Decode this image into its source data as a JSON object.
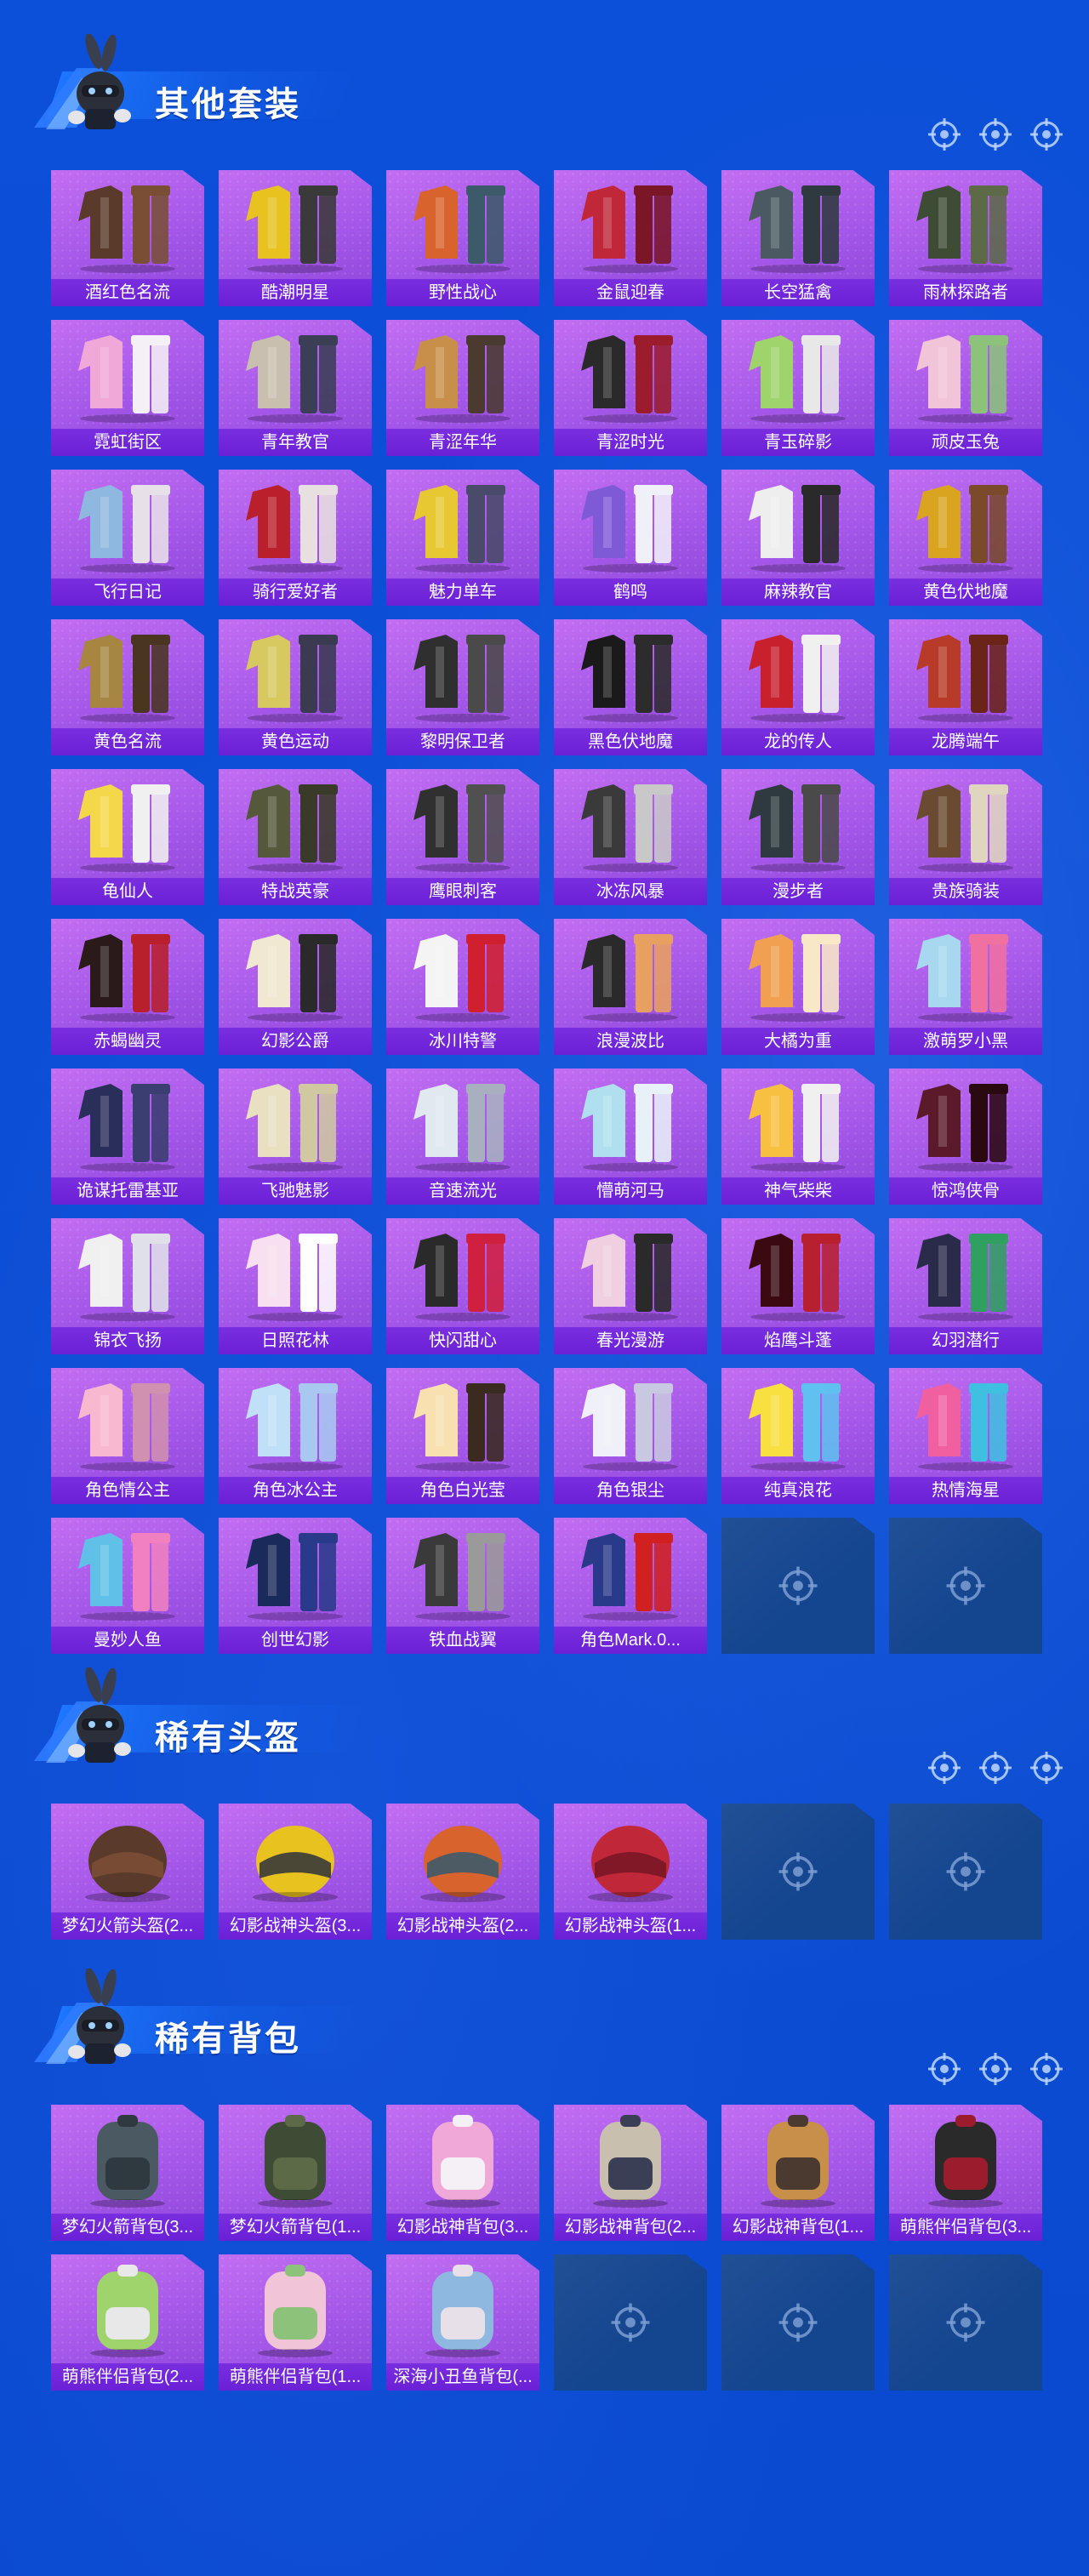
{
  "sections": [
    {
      "title": "其他套装",
      "items": [
        "酒红色名流",
        "酷潮明星",
        "野性战心",
        "金鼠迎春",
        "长空猛禽",
        "雨林探路者",
        "霓虹街区",
        "青年教官",
        "青涩年华",
        "青涩时光",
        "青玉碎影",
        "顽皮玉兔",
        "飞行日记",
        "骑行爱好者",
        "魅力单车",
        "鹤鸣",
        "麻辣教官",
        "黄色伏地魔",
        "黄色名流",
        "黄色运动",
        "黎明保卫者",
        "黑色伏地魔",
        "龙的传人",
        "龙腾端午",
        "龟仙人",
        "特战英豪",
        "鹰眼刺客",
        "冰冻风暴",
        "漫步者",
        "贵族骑装",
        "赤蝎幽灵",
        "幻影公爵",
        "冰川特警",
        "浪漫波比",
        "大橘为重",
        "激萌罗小黑",
        "诡谋托雷基亚",
        "飞驰魅影",
        "音速流光",
        "懵萌河马",
        "神气柴柴",
        "惊鸿侠骨",
        "锦衣飞扬",
        "日照花林",
        "快闪甜心",
        "春光漫游",
        "焰鹰斗蓬",
        "幻羽潜行",
        "角色情公主",
        "角色冰公主",
        "角色白光莹",
        "角色银尘",
        "纯真浪花",
        "热情海星",
        "曼妙人鱼",
        "创世幻影",
        "铁血战翼",
        "角色Mark.0..."
      ],
      "empty_slots": 2
    },
    {
      "title": "稀有头盔",
      "items": [
        "梦幻火箭头盔(2...",
        "幻影战神头盔(3...",
        "幻影战神头盔(2...",
        "幻影战神头盔(1..."
      ],
      "empty_slots": 2
    },
    {
      "title": "稀有背包",
      "items": [
        "梦幻火箭背包(3...",
        "梦幻火箭背包(1...",
        "幻影战神背包(3...",
        "幻影战神背包(2...",
        "幻影战神背包(1...",
        "萌熊伴侣背包(3...",
        "萌熊伴侣背包(2...",
        "萌熊伴侣背包(1...",
        "深海小丑鱼背包(..."
      ],
      "empty_slots": 3
    }
  ],
  "colors": {
    "background": "#0b4fd6",
    "card": "#a457e8",
    "label_bar": "#6a20d6",
    "empty_slot": "#14458f"
  },
  "icons": {
    "section_mascot": "bunny-soldier-mascot-icon",
    "section_decor": "crosshair-icon",
    "empty_slot": "crosshair-icon"
  }
}
